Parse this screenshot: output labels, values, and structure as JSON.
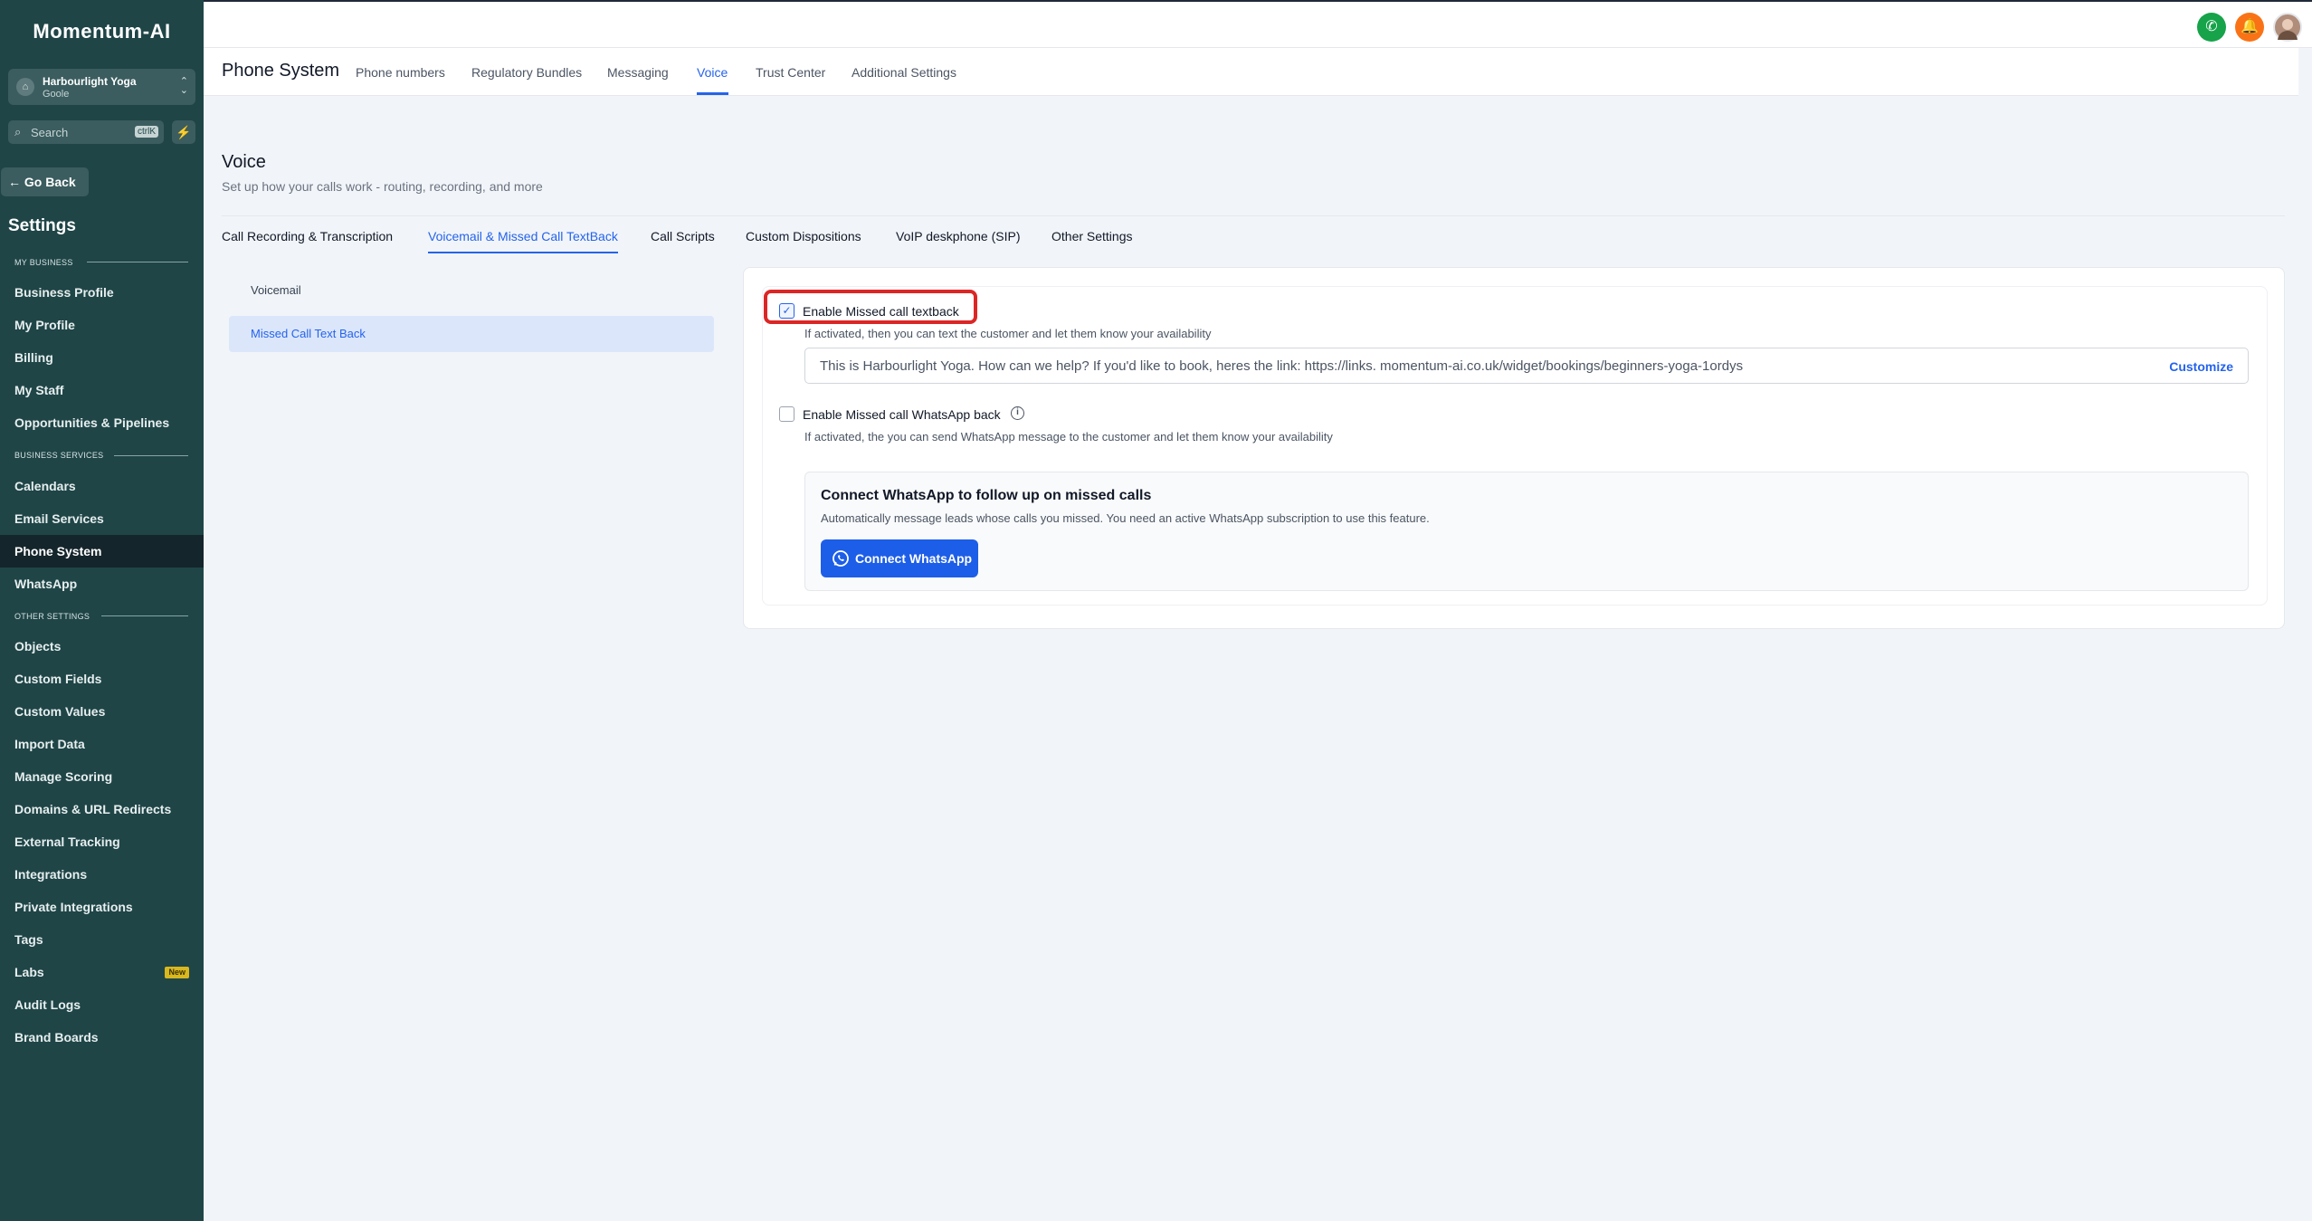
{
  "app": {
    "logo": "Momentum-AI"
  },
  "account": {
    "name": "Harbourlight Yoga",
    "location": "Goole"
  },
  "search": {
    "placeholder": "Search",
    "shortcut": "ctrlK"
  },
  "sidebar": {
    "go_back": "Go Back",
    "title": "Settings",
    "sections": {
      "my_business": "MY BUSINESS",
      "business_services": "BUSINESS SERVICES",
      "other_settings": "OTHER SETTINGS"
    },
    "items": [
      {
        "label": "Business Profile"
      },
      {
        "label": "My Profile"
      },
      {
        "label": "Billing"
      },
      {
        "label": "My Staff"
      },
      {
        "label": "Opportunities & Pipelines"
      },
      {
        "label": "Calendars"
      },
      {
        "label": "Email Services"
      },
      {
        "label": "Phone System"
      },
      {
        "label": "WhatsApp"
      },
      {
        "label": "Objects"
      },
      {
        "label": "Custom Fields"
      },
      {
        "label": "Custom Values"
      },
      {
        "label": "Import Data"
      },
      {
        "label": "Manage Scoring"
      },
      {
        "label": "Domains & URL Redirects"
      },
      {
        "label": "External Tracking"
      },
      {
        "label": "Integrations"
      },
      {
        "label": "Private Integrations"
      },
      {
        "label": "Tags"
      },
      {
        "label": "Labs",
        "badge": "New"
      },
      {
        "label": "Audit Logs"
      },
      {
        "label": "Brand Boards"
      }
    ]
  },
  "header": {
    "title": "Phone System",
    "tabs": [
      "Phone numbers",
      "Regulatory Bundles",
      "Messaging",
      "Voice",
      "Trust Center",
      "Additional Settings"
    ],
    "active_tab": "Voice"
  },
  "page": {
    "title": "Voice",
    "subtitle": "Set up how your calls work - routing, recording, and more",
    "subtabs": [
      "Call Recording & Transcription",
      "Voicemail & Missed Call TextBack",
      "Call Scripts",
      "Custom Dispositions",
      "VoIP deskphone (SIP)",
      "Other Settings"
    ],
    "active_subtab": "Voicemail & Missed Call TextBack"
  },
  "left_list": [
    "Voicemail",
    "Missed Call Text Back"
  ],
  "missed_call": {
    "textback_label": "Enable Missed call textback",
    "textback_checked": true,
    "textback_help": "If activated, then you can text the customer and let them know your availability",
    "message": "This is Harbourlight Yoga. How can we help? If you'd like to book, heres the link: https://links. momentum-ai.co.uk/widget/bookings/beginners-yoga-1ordys",
    "customize": "Customize",
    "whatsapp_label": "Enable Missed call WhatsApp back",
    "whatsapp_checked": false,
    "whatsapp_help": "If activated, the you can send WhatsApp message to the customer and let them know your availability",
    "wa_panel_title": "Connect WhatsApp to follow up on missed calls",
    "wa_panel_sub": "Automatically message leads whose calls you missed. You need an active WhatsApp subscription to use this feature.",
    "wa_button": "Connect WhatsApp"
  },
  "colors": {
    "sidebar": "#1f4547",
    "accent": "#2563eb",
    "highlight": "#dc2626",
    "call": "#16a34a",
    "bell": "#f97316"
  }
}
